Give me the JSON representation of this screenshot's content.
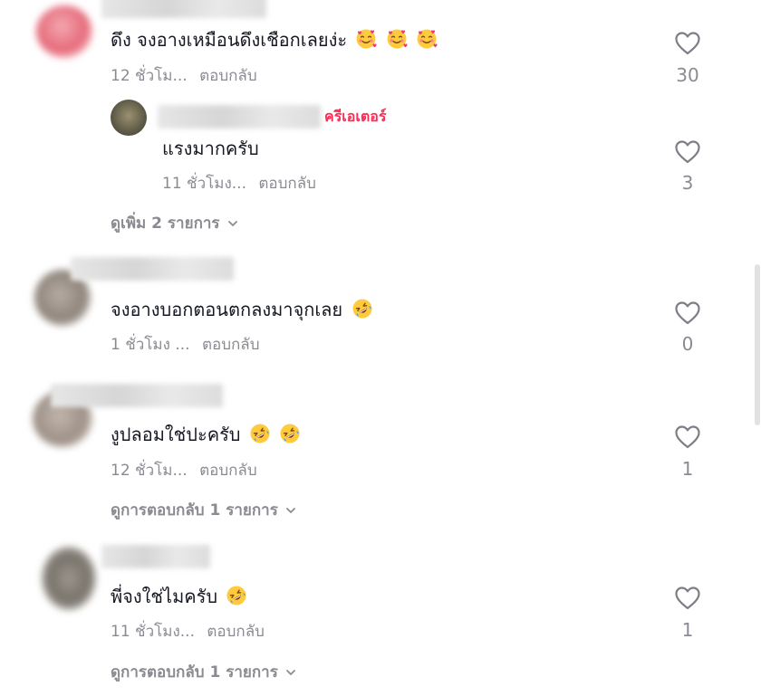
{
  "comments": [
    {
      "text": "ดึง จงอางเหมือนดึงเชือกเลยง่ะ",
      "time": "12 ชั่วโม...",
      "reply_label": "ตอบกลับ",
      "likes": "30",
      "emojis": [
        "smiling-face-with-hearts",
        "smiling-face-with-hearts",
        "smiling-face-with-hearts"
      ]
    },
    {
      "text": "แรงมากครับ",
      "time": "11 ชั่วโมง...",
      "reply_label": "ตอบกลับ",
      "likes": "3",
      "creator_badge": "ครีเอเตอร์"
    },
    {
      "text": "จงอางบอกตอนตกลงมาจุกเลย",
      "time": "1 ชั่วโมง ...",
      "reply_label": "ตอบกลับ",
      "likes": "0",
      "emojis": [
        "rolling-on-floor-laughing"
      ]
    },
    {
      "text": "งูปลอมใช่ปะครับ",
      "time": "12 ชั่วโม...",
      "reply_label": "ตอบกลับ",
      "likes": "1",
      "emojis": [
        "rolling-on-floor-laughing",
        "rolling-on-floor-laughing"
      ]
    },
    {
      "text": "พี่จงใช่ไมครับ",
      "time": "11 ชั่วโมง...",
      "reply_label": "ตอบกลับ",
      "likes": "1",
      "emojis": [
        "rolling-on-floor-laughing"
      ]
    }
  ],
  "view_more": "ดูเพิ่ม 2 รายการ",
  "view_replies": [
    "ดูการตอบกลับ 1 รายการ",
    "ดูการตอบกลับ 1 รายการ"
  ],
  "colors": {
    "creator": "#fe2c55",
    "meta": "#8a8b91",
    "text": "#161823"
  }
}
